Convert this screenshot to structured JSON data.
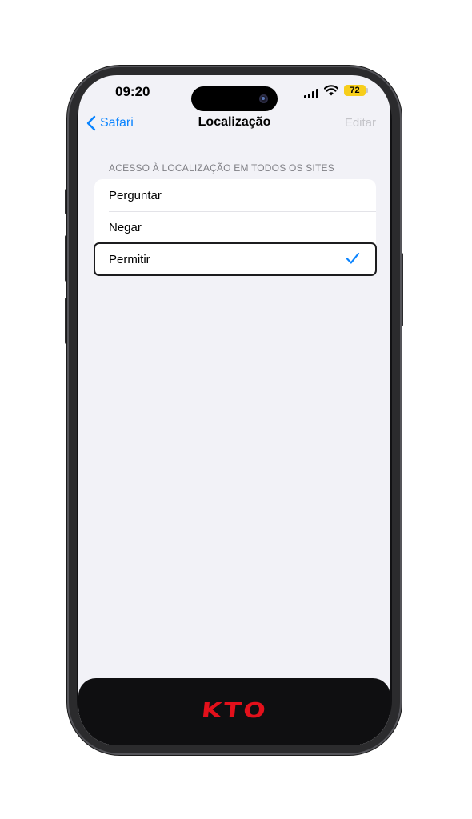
{
  "status_bar": {
    "time": "09:20",
    "battery": "72",
    "battery_color": "#f7ce1b"
  },
  "nav": {
    "back_label": "Safari",
    "title": "Localização",
    "edit_label": "Editar",
    "accent_color": "#0a84ff"
  },
  "section": {
    "header": "ACESSO À LOCALIZAÇÃO EM TODOS OS SITES",
    "options": [
      {
        "label": "Perguntar",
        "selected": false
      },
      {
        "label": "Negar",
        "selected": false
      },
      {
        "label": "Permitir",
        "selected": true
      }
    ]
  },
  "banner": {
    "logo_text": "KTO",
    "logo_color": "#e3101b"
  }
}
